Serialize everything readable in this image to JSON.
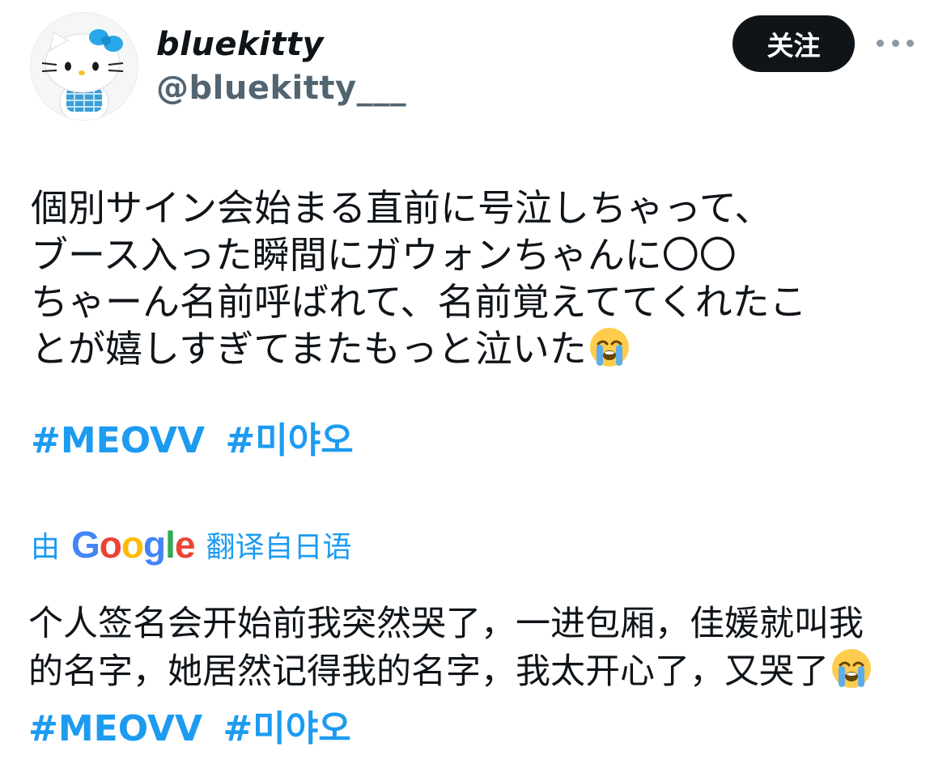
{
  "author": {
    "display_name": "bluekitty",
    "handle": "@bluekitty___"
  },
  "actions": {
    "follow_label": "关注"
  },
  "tweet": {
    "lines": [
      "個別サイン会始まる直前に号泣しちゃって、",
      "ブース入った瞬間にガウォンちゃんに〇〇",
      "ちゃーん名前呼ばれて、名前覚えててくれたこ",
      "とが嬉しすぎてまたもっと泣いた"
    ],
    "hashtags": [
      "#MEOVV",
      "#미야오"
    ]
  },
  "translation": {
    "prefix": "由",
    "google": [
      "G",
      "o",
      "o",
      "g",
      "l",
      "e"
    ],
    "suffix": "翻译自日语",
    "lines": [
      "个人签名会开始前我突然哭了，一进包厢，佳媛就叫我",
      "的名字，她居然记得我的名字，我太开心了，又哭了"
    ],
    "hashtags": [
      "#MEOVV",
      "#미야오"
    ]
  },
  "colors": {
    "link": "#1d9bf0",
    "text": "#0f1419",
    "secondary": "#536471",
    "google_blue": "#4285F4",
    "google_red": "#EA4335",
    "google_yellow": "#FBBC05",
    "google_green": "#34A853"
  },
  "icons": {
    "more": "more-horizontal-icon",
    "emoji": "loudly-crying-face-emoji"
  }
}
